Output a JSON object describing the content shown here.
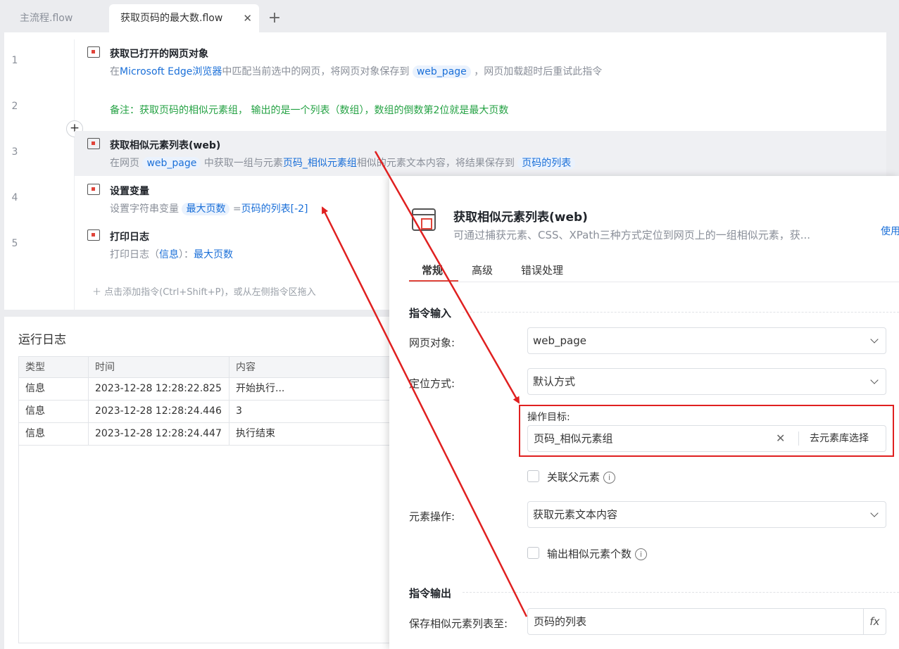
{
  "tabs": [
    {
      "label": "主流程.flow"
    },
    {
      "label": "获取页码的最大数.flow",
      "close": "✕"
    }
  ],
  "tab_add": "+",
  "editor": {
    "line_numbers": [
      "1",
      "2",
      "3",
      "4",
      "5"
    ],
    "steps": [
      {
        "title": "获取已打开的网页对象",
        "desc_parts": [
          "在",
          "Microsoft Edge浏览器",
          "中匹配当前选中的网页，将网页对象保存到",
          "web_page",
          "，网页加载超时后重试此指令"
        ]
      },
      {
        "comment": "备注：获取页码的相似元素组， 输出的是一个列表（数组），数组的倒数第2位就是最大页数"
      },
      {
        "title": "获取相似元素列表(web)",
        "desc_parts": [
          "在网页",
          "web_page",
          "中获取一组与元素",
          "页码_相似元素组",
          "相似的元素文本内容，将结果保存到",
          "页码的列表"
        ]
      },
      {
        "title": "设置变量",
        "desc_parts": [
          "设置字符串变量",
          "最大页数",
          "=",
          "页码的列表[-2]"
        ]
      },
      {
        "title": "打印日志",
        "desc_parts": [
          "打印日志（",
          "信息",
          "）：",
          "最大页数"
        ]
      }
    ],
    "insert_plus": "+",
    "add_hint": "＋  点击添加指令(Ctrl+Shift+P)，或从左侧指令区拖入"
  },
  "log": {
    "title": "运行日志",
    "columns": [
      "类型",
      "时间",
      "内容"
    ],
    "rows": [
      [
        "信息",
        "2023-12-28 12:28:22.825",
        "开始执行..."
      ],
      [
        "信息",
        "2023-12-28 12:28:24.446",
        "3"
      ],
      [
        "信息",
        "2023-12-28 12:28:24.447",
        "执行结束"
      ]
    ]
  },
  "props": {
    "title": "获取相似元素列表(web)",
    "subtitle": "可通过捕获元素、CSS、XPath三种方式定位到网页上的一组相似元素，获...",
    "help": "使用",
    "tabs": [
      "常规",
      "高级",
      "错误处理"
    ],
    "input_section": "指令输入",
    "web_object_label": "网页对象:",
    "web_object_value": "web_page",
    "locate_label": "定位方式:",
    "locate_value": "默认方式",
    "target_label": "操作目标:",
    "target_value": "页码_相似元素组",
    "target_clear": "✕",
    "target_button": "去元素库选择",
    "relate_parent": "关联父元素",
    "element_op_label": "元素操作:",
    "element_op_value": "获取元素文本内容",
    "output_count": "输出相似元素个数",
    "info_glyph": "i",
    "output_section": "指令输出",
    "save_label": "保存相似元素列表至:",
    "save_value": "页码的列表",
    "fx": "fx"
  },
  "colors": {
    "accent": "#e0443a",
    "link": "#1a6fd8",
    "comment": "#25a244",
    "annotation": "#e02020"
  }
}
